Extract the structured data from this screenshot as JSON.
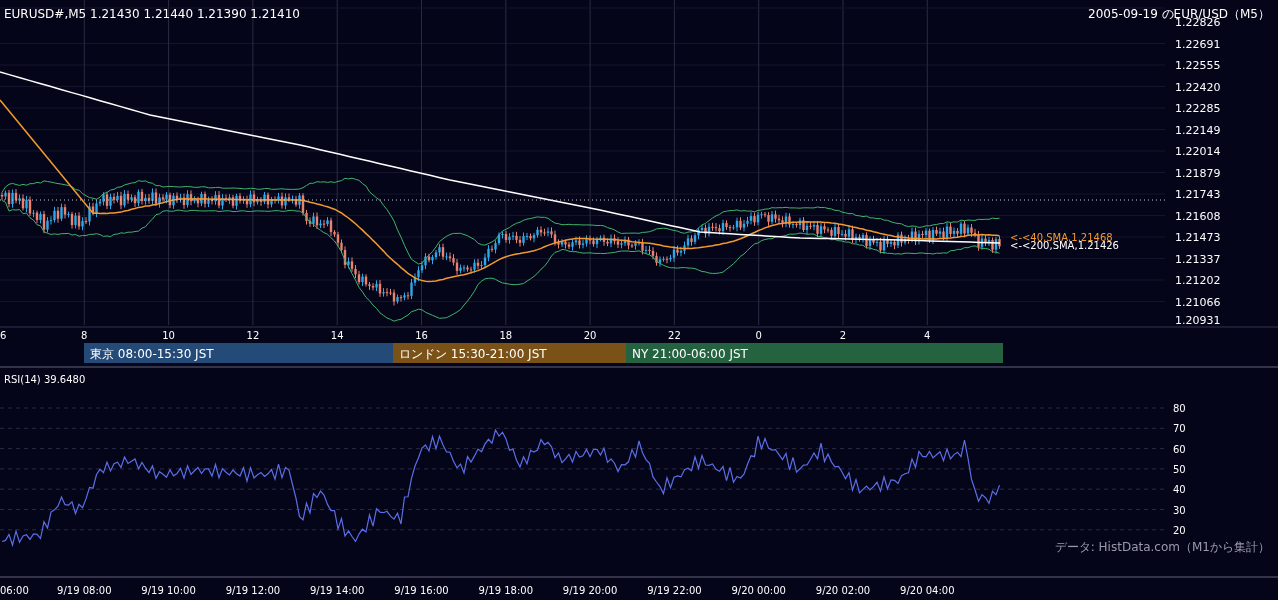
{
  "header": {
    "quote": "EURUSD#,M5 1.21430 1.21440 1.21390 1.21410",
    "title": "2005-09-19 のEUR/USD（M5）"
  },
  "price_chart": {
    "y_axis_labels": [
      "1.22826",
      "1.22691",
      "1.22555",
      "1.22420",
      "1.22285",
      "1.22149",
      "1.22014",
      "1.21879",
      "1.21743",
      "1.21608",
      "1.21473",
      "1.21337",
      "1.21202",
      "1.21066",
      "1.20931"
    ],
    "x_axis_labels": [
      "6",
      "8",
      "10",
      "12",
      "14",
      "16",
      "18",
      "20",
      "22",
      "0",
      "2",
      "4"
    ],
    "sma_labels": [
      {
        "text": "<-<40,SMA,1.21468",
        "color": "#f29a2e"
      },
      {
        "text": "<-<200,SMA,1.21426",
        "color": "#ffffff"
      }
    ]
  },
  "sessions": [
    {
      "label": "東京 08:00-15:30 JST",
      "color": "#244a77"
    },
    {
      "label": "ロンドン 15:30-21:00 JST",
      "color": "#7a5218"
    },
    {
      "label": "NY 21:00-06:00 JST",
      "color": "#256240"
    }
  ],
  "rsi": {
    "label": "RSI(14) 39.6480",
    "y_axis_labels": [
      "80",
      "70",
      "60",
      "50",
      "40",
      "30",
      "20"
    ],
    "credit": "データ: HistData.com（M1から集計）"
  },
  "time_axis": [
    "06:00",
    "9/19 08:00",
    "9/19 10:00",
    "9/19 12:00",
    "9/19 14:00",
    "9/19 16:00",
    "9/19 18:00",
    "9/19 20:00",
    "9/19 22:00",
    "9/20 00:00",
    "9/20 02:00",
    "9/20 04:00"
  ]
}
